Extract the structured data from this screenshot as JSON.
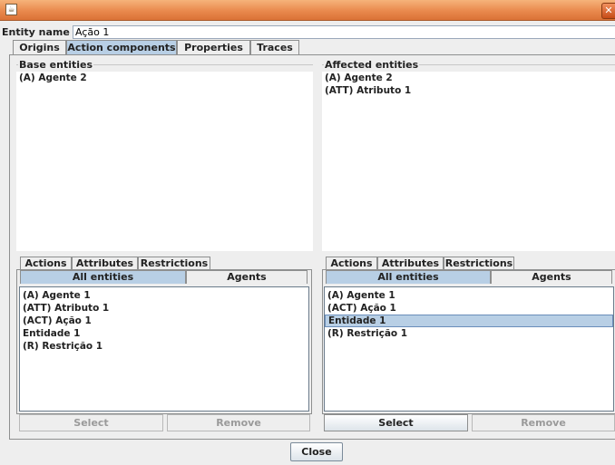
{
  "window": {
    "icon": "java-icon",
    "close_glyph": "✕"
  },
  "entity": {
    "label": "Entity name",
    "value": "Ação 1"
  },
  "main_tabs": [
    "Origins",
    "Action components",
    "Properties",
    "Traces"
  ],
  "left": {
    "title": "Base entities",
    "entities": [
      "(A) Agente 2"
    ],
    "type_tabs": [
      "Actions",
      "Attributes",
      "Restrictions"
    ],
    "view_tabs": [
      "All entities",
      "Agents"
    ],
    "list": [
      "(A) Agente 1",
      "(ATT) Atributo 1",
      "(ACT) Ação 1",
      "Entidade 1",
      "(R) Restrição 1"
    ],
    "select_label": "Select",
    "remove_label": "Remove"
  },
  "right": {
    "title": "Affected entities",
    "entities": [
      "(A) Agente 2",
      "(ATT) Atributo 1"
    ],
    "type_tabs": [
      "Actions",
      "Attributes",
      "Restrictions"
    ],
    "view_tabs": [
      "All entities",
      "Agents"
    ],
    "list": [
      "(A) Agente 1",
      "(ACT) Ação 1",
      "Entidade 1",
      "(R) Restrição 1"
    ],
    "selected_index": 2,
    "select_label": "Select",
    "remove_label": "Remove"
  },
  "close_label": "Close"
}
